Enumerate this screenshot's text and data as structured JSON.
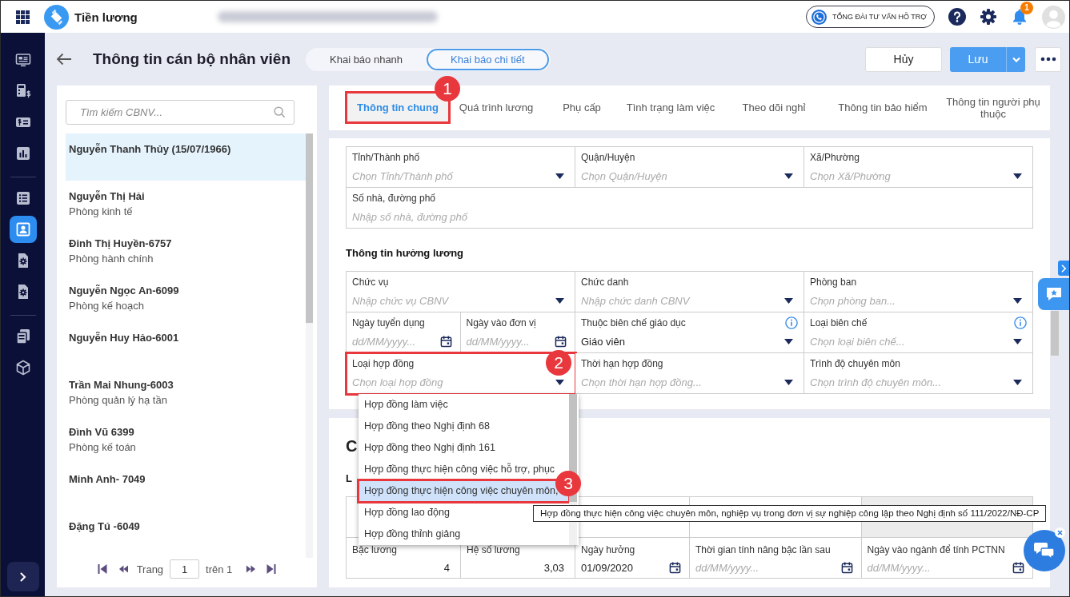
{
  "app": {
    "name": "Tiền lương"
  },
  "topbar": {
    "hotline": "TỔNG ĐÀI TƯ VẤN HỖ TRỢ",
    "notification_count": "1"
  },
  "sidebar": {
    "groups": [
      [
        {
          "selected": false
        },
        {
          "selected": false
        },
        {
          "selected": false
        },
        {
          "selected": false
        }
      ],
      [
        {
          "selected": false
        },
        {
          "selected": true
        },
        {
          "selected": false
        },
        {
          "selected": false
        }
      ],
      [
        {
          "selected": false
        },
        {
          "selected": false
        }
      ]
    ]
  },
  "page": {
    "title": "Thông tin cán bộ nhân viên",
    "modes": [
      {
        "label": "Khai báo nhanh",
        "selected": false
      },
      {
        "label": "Khai báo chi tiết",
        "selected": true
      }
    ],
    "actions": {
      "cancel": "Hủy",
      "save": "Lưu"
    }
  },
  "employee_list": {
    "search": {
      "placeholder": "Tìm kiếm CBNV..."
    },
    "items": [
      {
        "name": "Nguyễn Thanh Thủy (15/07/1966)",
        "selected": true
      },
      {
        "name": "Nguyễn Thị Hải",
        "department": "Phòng kinh tế",
        "selected": false
      },
      {
        "name": "Đinh Thị Huyền-6757",
        "department": "Phòng hành chính",
        "selected": false
      },
      {
        "name": "Nguyễn Ngọc An-6099",
        "department": "Phòng kế hoạch",
        "selected": false
      },
      {
        "name": "Nguyễn Huy Hảo-6001",
        "selected": false
      },
      {
        "name": "Trần Mai Nhung-6003",
        "department": "Phòng quản lý hạ tần",
        "selected": false
      },
      {
        "name": "Đình Vũ 6399",
        "department": "Phòng kế toán",
        "selected": false
      },
      {
        "name": "Minh Anh- 7049",
        "selected": false
      },
      {
        "name": "Đặng Tú -6049",
        "selected": false
      }
    ],
    "pagination": {
      "label": "Trang",
      "page": "1",
      "total": "trên 1"
    }
  },
  "tabs": [
    {
      "label": "Thông tin chung",
      "selected": true,
      "callout": "1"
    },
    {
      "label": "Quá trình lương",
      "selected": false
    },
    {
      "label": "Phụ cấp",
      "selected": false
    },
    {
      "label": "Tình trạng làm việc",
      "selected": false
    },
    {
      "label": "Theo dõi nghỉ",
      "selected": false
    },
    {
      "label": "Thông tin bảo hiểm",
      "selected": false
    },
    {
      "label": "Thông tin người phụ thuộc",
      "selected": false
    }
  ],
  "address": {
    "rows": [
      [
        {
          "label": "Tỉnh/Thành phố",
          "placeholder": "Chọn Tỉnh/Thành phố",
          "kind": "select"
        },
        {
          "label": "Quận/Huyện",
          "placeholder": "Chọn Quận/Huyện",
          "kind": "select"
        },
        {
          "label": "Xã/Phường",
          "placeholder": "Chọn Xã/Phường",
          "kind": "select"
        }
      ],
      [
        {
          "label": "Số nhà, đường phố",
          "placeholder": "Nhập số nhà, đường phố",
          "kind": "text"
        }
      ]
    ]
  },
  "salary": {
    "title": "Thông tin hưởng lương",
    "rows": [
      [
        {
          "label": "Chức vụ",
          "placeholder": "Nhập chức vụ CBNV",
          "kind": "select"
        },
        {
          "label": "Chức danh",
          "placeholder": "Nhập chức danh CBNV",
          "kind": "select"
        },
        {
          "label": "Phòng ban",
          "placeholder": "Chọn phòng ban...",
          "kind": "select"
        }
      ],
      [
        {
          "kind": "split",
          "fields": [
            {
              "label": "Ngày tuyển dụng",
              "placeholder": "dd/MM/yyyy...",
              "kind": "date"
            },
            {
              "label": "Ngày vào đơn vị",
              "placeholder": "dd/MM/yyyy...",
              "kind": "date"
            }
          ]
        },
        {
          "label": "Thuộc biên chế giáo dục",
          "value": "Giáo viên",
          "kind": "select",
          "info": true
        },
        {
          "label": "Loại biên chế",
          "placeholder": "Chọn loại biên chế...",
          "kind": "select",
          "info": true
        }
      ],
      [
        {
          "label": "Loại hợp đồng",
          "placeholder": "Chọn loại hợp đồng",
          "kind": "select",
          "callout": "2",
          "expanded": true,
          "options": [
            {
              "label": "Hợp đồng làm việc",
              "selected": false
            },
            {
              "label": "Hợp đồng theo Nghị định 68",
              "selected": false
            },
            {
              "label": "Hợp đồng theo Nghị định 161",
              "selected": false
            },
            {
              "label": "Hợp đồng thực hiện công việc hỗ trợ, phục",
              "selected": false
            },
            {
              "label": "Hợp đồng thực hiện công việc chuyên môn,",
              "selected": true,
              "callout": "3",
              "tooltip": "Hợp đồng thực hiện công việc chuyên môn, nghiệp vụ trong đơn vị sự nghiệp công lập theo Nghị định số 111/2022/NĐ-CP"
            },
            {
              "label": "Hợp đồng lao động",
              "selected": false
            },
            {
              "label": "Hợp đồng thỉnh giảng",
              "selected": false
            }
          ]
        },
        {
          "label": "Thời hạn hợp đồng",
          "placeholder": "Chọn thời hạn hợp đồng...",
          "kind": "select"
        },
        {
          "label": "Trình độ chuyên môn",
          "placeholder": "Chọn trình độ chuyên môn...",
          "kind": "select"
        }
      ]
    ]
  },
  "lower_section": {
    "title": "C",
    "subtitle": "L",
    "rows": [
      [
        {
          "kind": "blank",
          "disabled": false
        },
        {
          "kind": "blank"
        },
        {
          "kind": "blank",
          "disabled": false
        },
        {
          "kind": "blank",
          "disabled": false
        },
        {
          "kind": "blank",
          "disabled": true
        }
      ],
      [
        {
          "label": "Bậc lương",
          "value": "4",
          "kind": "number"
        },
        {
          "label": "Hệ số lương",
          "value": "3,03",
          "kind": "number"
        },
        {
          "label": "Ngày hưởng",
          "value": "01/09/2020",
          "kind": "date"
        },
        {
          "label": "Thời gian tính nâng bậc lần sau",
          "placeholder": "dd/MM/yyyy...",
          "kind": "date"
        },
        {
          "label": "Ngày vào ngành để tính PCTNN",
          "placeholder": "dd/MM/yyyy...",
          "kind": "date"
        }
      ]
    ]
  }
}
